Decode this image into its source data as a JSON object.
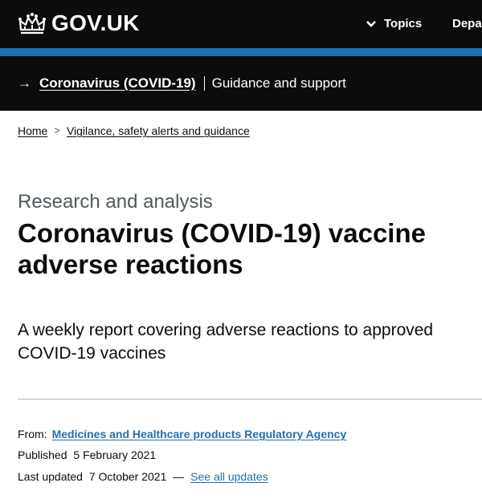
{
  "header": {
    "logo_text": "GOV.UK",
    "nav_topics": "Topics",
    "nav_departments": "Depa"
  },
  "covid_banner": {
    "arrow": "→",
    "link_text": "Coronavirus (COVID-19)",
    "tail_text": "Guidance and support"
  },
  "breadcrumb": {
    "items": [
      "Home",
      "Vigilance, safety alerts and guidance"
    ],
    "separator": ">"
  },
  "page": {
    "caption": "Research and analysis",
    "title": "Coronavirus (COVID-19) vaccine adverse reactions",
    "summary": "A weekly report covering adverse reactions to approved COVID-19 vaccines"
  },
  "metadata": {
    "from_label": "From:",
    "from_org": "Medicines and Healthcare products Regulatory Agency",
    "published_label": "Published",
    "published_date": "5 February 2021",
    "updated_label": "Last updated",
    "updated_date": "7 October 2021",
    "updated_dash": "—",
    "see_all_updates": "See all updates"
  },
  "colors": {
    "header_bg": "#0b0c0c",
    "accent_blue": "#1d70b8",
    "link_blue": "#1d70b8",
    "caption_grey": "#505a5f"
  },
  "icons": {
    "logo": "crown-icon",
    "topics": "chevron-down-icon",
    "breadcrumb_separator": "chevron-right-icon"
  }
}
